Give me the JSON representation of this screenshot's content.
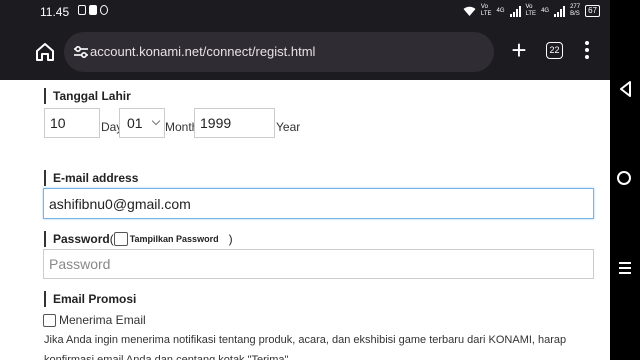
{
  "status_bar": {
    "time": "11.45",
    "network_left": "Vo\nLTE",
    "net_4g": "4G",
    "network_right": "Vo\nLTE",
    "data_rate": "277\nB/S",
    "battery": "67"
  },
  "browser": {
    "url": "account.konami.net/connect/regist.html",
    "tab_count": "22",
    "icons": [
      "home-icon",
      "site-settings-icon",
      "plus-icon",
      "tabs-icon",
      "more-menu-icon"
    ]
  },
  "form": {
    "birth": {
      "label": "Tanggal Lahir",
      "day_value": "10",
      "day_label": "Day",
      "month_value": "01",
      "month_label": "Month",
      "year_value": "1999",
      "year_label": "Year"
    },
    "email": {
      "label": "E-mail address",
      "value": "ashifibnu0@gmail.com"
    },
    "password": {
      "label": "Password",
      "paren_open": "(",
      "show_label": "Tampilkan Password",
      "paren_close": ")",
      "placeholder": "Password"
    },
    "promo": {
      "label": "Email Promosi",
      "accept_label": "Menerima Email",
      "description": "Jika Anda ingin menerima notifikasi tentang produk, acara, dan ekshibisi game terbaru dari KONAMI, harap konfirmasi email Anda dan centang kotak \"Terima\"."
    }
  }
}
